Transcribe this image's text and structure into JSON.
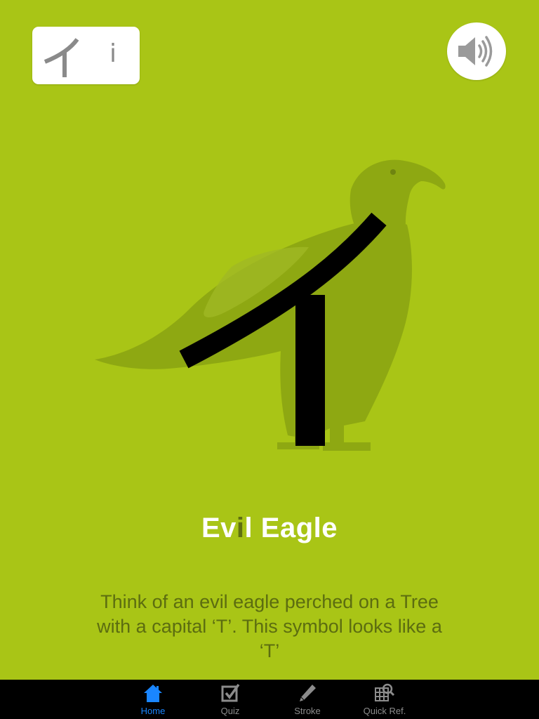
{
  "card": {
    "kana": "イ",
    "romaji": "i"
  },
  "sound": {
    "icon": "speaker-icon"
  },
  "mnemonic": {
    "title_before": "Ev",
    "title_highlight": "i",
    "title_after": "l Eagle",
    "description": "Think of an evil eagle perched on a Tree with a capital ‘T’. This symbol looks like a ‘T’"
  },
  "tabbar": {
    "tabs": [
      {
        "label": "Home",
        "icon": "home-icon",
        "active": true
      },
      {
        "label": "Quiz",
        "icon": "checkbox-icon",
        "active": false
      },
      {
        "label": "Stroke",
        "icon": "pencil-icon",
        "active": false
      },
      {
        "label": "Quick Ref.",
        "icon": "grid-search-icon",
        "active": false
      }
    ]
  },
  "colors": {
    "background": "#a9c516",
    "eagle": "#8aa410",
    "title_highlight": "#5f7010",
    "description_text": "#5c6d10",
    "tab_active": "#1a86ff",
    "tab_inactive": "#8c8c8c"
  }
}
